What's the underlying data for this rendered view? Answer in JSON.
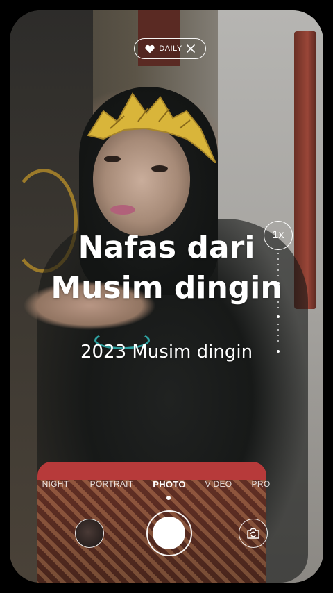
{
  "badge": {
    "label": "DAILY",
    "icon": "heart-icon",
    "close_icon": "close-icon"
  },
  "caption": {
    "title_line1": "Nafas dari",
    "title_line2": "Musim dingin",
    "subtitle": "2023 Musim dingin"
  },
  "zoom": {
    "label": "1x"
  },
  "modes": {
    "items": [
      "NIGHT",
      "PORTRAIT",
      "PHOTO",
      "VIDEO",
      "PRO"
    ],
    "selected": "PHOTO"
  },
  "controls": {
    "gallery_icon": "gallery-thumbnail",
    "shutter_icon": "shutter-button",
    "flip_icon": "camera-flip-icon"
  },
  "colors": {
    "overlay_text": "#ffffff",
    "accent_bracelet": "#2fa3a3",
    "crown_gold": "#d9b53a"
  }
}
